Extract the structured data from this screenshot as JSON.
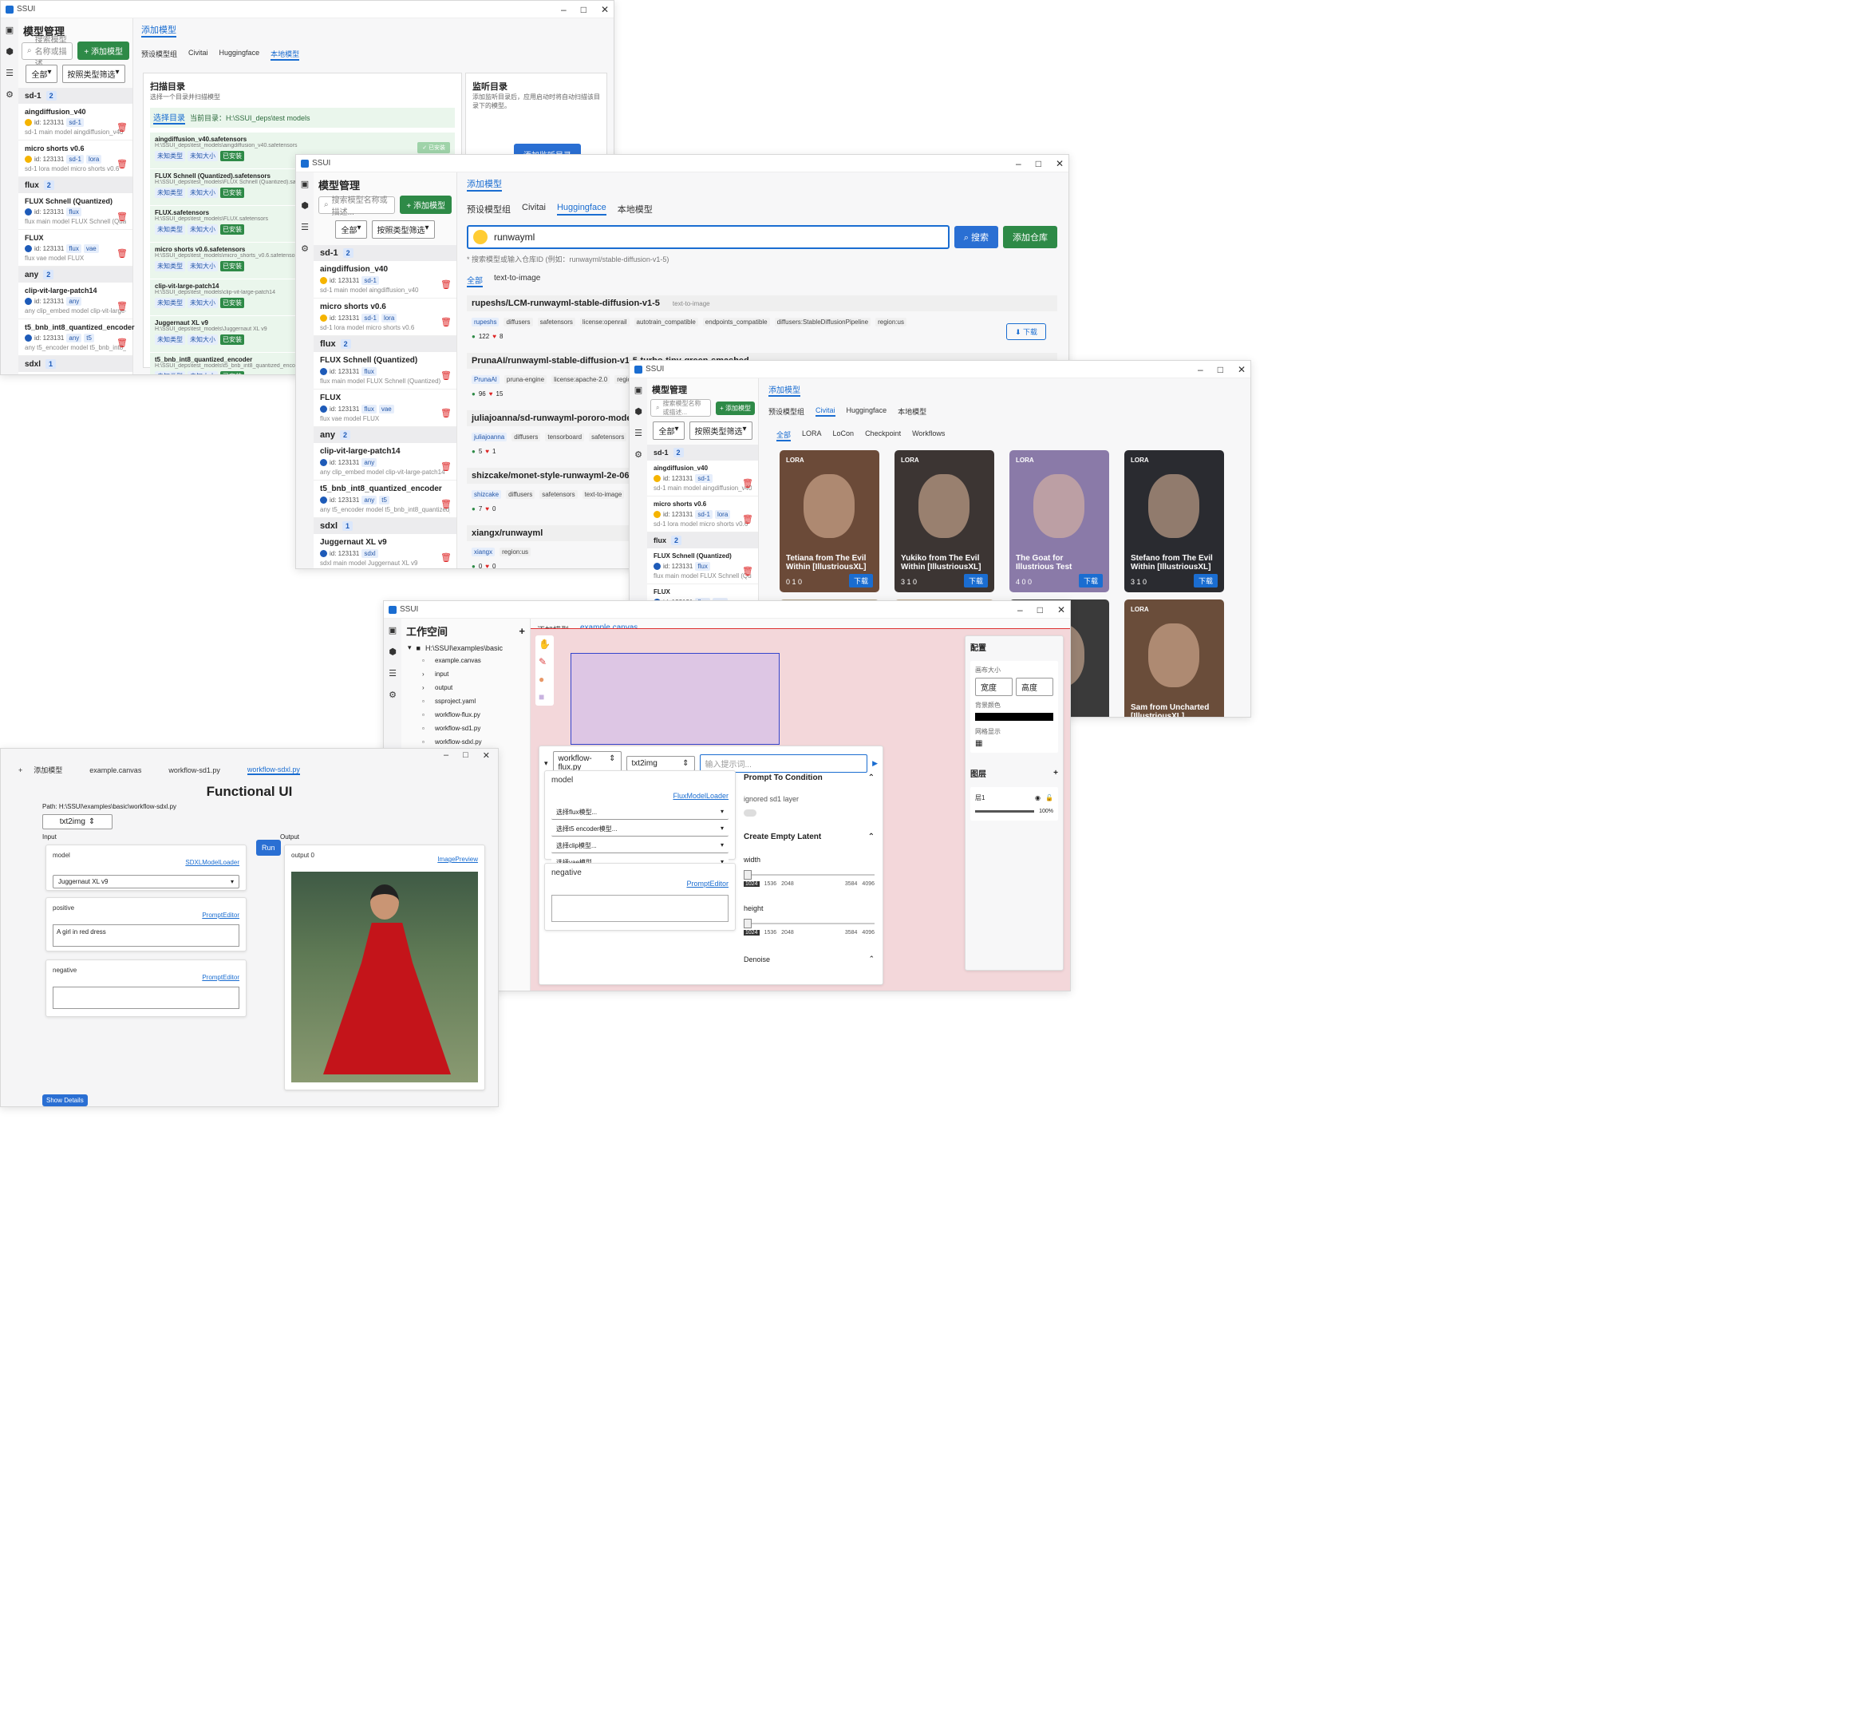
{
  "app": {
    "title": "SSUI",
    "win_min": "–",
    "win_max": "□",
    "win_close": "✕"
  },
  "w1": {
    "sidebar": {
      "title": "模型管理",
      "search_placeholder": "搜索模型名称或描述...",
      "add_model": "+ 添加模型",
      "filter_all": "全部",
      "filter_sort": "按照类型筛选",
      "groups": [
        {
          "name": "sd-1",
          "count": "2",
          "items": [
            {
              "name": "aingdiffusion_v40",
              "id": "id: 123131",
              "tag": "sd-1",
              "path": "sd-1 main model aingdiffusion_v40"
            },
            {
              "name": "micro shorts v0.6",
              "id": "id: 123131",
              "tag": "sd-1",
              "tag2": "lora",
              "path": "sd-1 lora model micro shorts v0.6"
            }
          ]
        },
        {
          "name": "flux",
          "count": "2",
          "items": [
            {
              "name": "FLUX Schnell (Quantized)",
              "id": "id: 123131",
              "tag": "flux",
              "path": "flux main model FLUX Schnell (Quantized)"
            },
            {
              "name": "FLUX",
              "id": "id: 123131",
              "tag": "flux",
              "tag2": "vae",
              "path": "flux vae model FLUX"
            }
          ]
        },
        {
          "name": "any",
          "count": "2",
          "items": [
            {
              "name": "clip-vit-large-patch14",
              "id": "id: 123131",
              "tag": "any",
              "path": "any clip_embed model clip-vit-large-patch14"
            },
            {
              "name": "t5_bnb_int8_quantized_encoder",
              "id": "id: 123131",
              "tag": "any",
              "tag2": "t5",
              "path": "any t5_encoder model t5_bnb_int8_quantized_encoder"
            }
          ]
        },
        {
          "name": "sdxl",
          "count": "1",
          "items": [
            {
              "name": "Juggernaut XL v9",
              "id": "id: 123131",
              "tag": "sdxl",
              "path": "sdxl main model Juggernaut XL v9"
            }
          ]
        }
      ]
    },
    "top_tab": "添加模型",
    "tabs": [
      "预设模型组",
      "Civitai",
      "Huggingface",
      "本地模型"
    ],
    "scan_title": "扫描目录",
    "scan_desc": "选择一个目录并扫描模型",
    "choose_dir": "选择目录",
    "current_dir": "当前目录：H:\\SSUI_deps\\test models",
    "files": [
      {
        "name": "aingdiffusion_v40.safetensors",
        "path": "H:\\SSUI_deps\\test_models\\aingdiffusion_v40.safetensors",
        "state": "✓ 已安装"
      },
      {
        "name": "FLUX Schnell (Quantized).safetensors",
        "path": "H:\\SSUI_deps\\test_models\\FLUX Schnell (Quantized).safetensors"
      },
      {
        "name": "FLUX.safetensors",
        "path": "H:\\SSUI_deps\\test_models\\FLUX.safetensors"
      },
      {
        "name": "micro shorts v0.6.safetensors",
        "path": "H:\\SSUI_deps\\test_models\\micro_shorts_v0.6.safetensors"
      },
      {
        "name": "clip-vit-large-patch14",
        "path": "H:\\SSUI_deps\\test_models\\clip-vit-large-patch14"
      },
      {
        "name": "Juggernaut XL v9",
        "path": "H:\\SSUI_deps\\test_models\\Juggernaut XL v9"
      },
      {
        "name": "t5_bnb_int8_quantized_encoder",
        "path": "H:\\SSUI_deps\\test_models\\t5_bnb_int8_quantized_encoder"
      }
    ],
    "file_tags": [
      "未知类型",
      "未知大小",
      "已安装"
    ],
    "watch_title": "监听目录",
    "watch_desc": "添加监听目录后，应用启动时将自动扫描该目录下的模型。",
    "add_watch": "添加监听目录"
  },
  "w2": {
    "top_tab": "添加模型",
    "tabs": [
      "预设模型组",
      "Civitai",
      "Huggingface",
      "本地模型"
    ],
    "search_value": "runwayml",
    "search_btn": "搜索",
    "add_repo": "添加仓库",
    "hint": "* 搜索模型或输入仓库ID (例如：runwayml/stable-diffusion-v1-5)",
    "filter_tabs": [
      "全部",
      "text-to-image"
    ],
    "results": [
      {
        "name": "rupeshs/LCM-runwayml-stable-diffusion-v1-5",
        "type": "text-to-image",
        "tags": [
          "rupeshs",
          "diffusers",
          "safetensors",
          "license:openrail",
          "autotrain_compatible",
          "endpoints_compatible",
          "diffusers:StableDiffusionPipeline",
          "region:us"
        ],
        "likes": "122",
        "hearts": "8",
        "download": "下载"
      },
      {
        "name": "PrunaAI/runwayml-stable-diffusion-v1-5-turbo-tiny-green-smashed",
        "tags": [
          "PrunaAI",
          "pruna-engine",
          "license:apache-2.0",
          "region:us"
        ],
        "likes": "96",
        "hearts": "15"
      },
      {
        "name": "juliajoanna/sd-runwayml-pororo-model",
        "type": "text",
        "tags": [
          "juliajoanna",
          "diffusers",
          "tensorboard",
          "safetensors",
          "base_model:finetune:runwayml/stable-diffusion-v1-5"
        ],
        "likes": "5",
        "hearts": "1"
      },
      {
        "name": "shizcake/monet-style-runwayml-2e-06-8-pix",
        "tags": [
          "shizcake",
          "diffusers",
          "safetensors",
          "text-to-image"
        ],
        "likes": "7",
        "hearts": "0"
      },
      {
        "name": "xiangx/runwayml",
        "tags": [
          "xiangx",
          "region:us"
        ],
        "likes": "0",
        "hearts": "0"
      }
    ]
  },
  "w3": {
    "top_tab": "添加模型",
    "tabs": [
      "预设模型组",
      "Civitai",
      "Huggingface",
      "本地模型"
    ],
    "filters": [
      "全部",
      "LORA",
      "LoCon",
      "Checkpoint",
      "Workflows"
    ],
    "cards": [
      {
        "type": "LORA",
        "title": "Tetiana from The Evil Within [IllustriousXL]",
        "stats": "0  1  0",
        "dl": "下载",
        "bg": "#6b4a38"
      },
      {
        "type": "LORA",
        "title": "Yukiko from The Evil Within [IllustriousXL]",
        "stats": "3  1  0",
        "dl": "下载",
        "bg": "#3c3533"
      },
      {
        "type": "LORA",
        "title": "The Goat for Illustrious Test",
        "stats": "4  0  0",
        "dl": "下载",
        "bg": "#8a7aa8"
      },
      {
        "type": "LORA",
        "title": "Stefano from The Evil Within [IllustriousXL]",
        "stats": "3  1  0",
        "dl": "下载",
        "bg": "#2a2b30"
      },
      {
        "type": "LORA",
        "title": "",
        "stats": "",
        "dl": "",
        "bg": "#b7a98f"
      },
      {
        "type": "LORA",
        "title": "",
        "stats": "",
        "dl": "",
        "bg": "#c8b090"
      },
      {
        "type": "LORA",
        "title": "Within [Illustri",
        "stats": "",
        "dl": "下载",
        "bg": "#3a3a3a"
      },
      {
        "type": "LORA",
        "title": "Sam from Uncharted [IllustriousXL]",
        "stats": "6  1  0",
        "dl": "下载",
        "bg": "#6a4d3a"
      }
    ]
  },
  "w4": {
    "workspace": "工作空间",
    "tree_root": "H:\\SSUI\\examples\\basic",
    "tree": [
      "example.canvas",
      "input",
      "output",
      "ssproject.yaml",
      "workflow-flux.py",
      "workflow-sd1.py",
      "workflow-sdxl.py"
    ],
    "tabs": [
      "添加模型",
      "example.canvas"
    ],
    "panel_workflow": "workflow-flux.py",
    "panel_mode": "txt2img",
    "prompt_placeholder": "输入提示词...",
    "model_label": "model",
    "model_link": "FluxModelLoader",
    "selects": [
      "选择flux模型...",
      "选择t5 encoder模型...",
      "选择clip模型...",
      "选择vae模型..."
    ],
    "negative_label": "negative",
    "negative_link": "PromptEditor",
    "right": {
      "s1": "Prompt To Condition",
      "s1_opt": "ignored sd1 layer",
      "s2": "Create Empty Latent",
      "width": "width",
      "height": "height",
      "w_val": "1024",
      "ticks": [
        "1536",
        "2048",
        "3584",
        "4096"
      ],
      "s3": "Denoise"
    },
    "config": {
      "title": "配置",
      "size_label": "画布大小",
      "w": "宽度",
      "h": "高度",
      "bg_label": "背景颜色",
      "grid_label": "网格显示"
    },
    "layers": {
      "title": "图层",
      "name": "层1",
      "opacity": "100%"
    }
  },
  "w5": {
    "tabs": [
      "添加模型",
      "example.canvas",
      "workflow-sd1.py",
      "workflow-sdxl.py"
    ],
    "title": "Functional UI",
    "path": "Path: H:\\SSUI\\examples\\basic\\workflow-sdxl.py",
    "mode": "txt2img",
    "input_label": "Input",
    "output_label": "Output",
    "run": "Run",
    "model_label": "model",
    "model_link": "SDXLModelLoader",
    "model_value": "Juggernaut XL v9",
    "positive_label": "positive",
    "positive_link": "PromptEditor",
    "positive_value": "A girl in red dress",
    "negative_label": "negative",
    "negative_link": "PromptEditor",
    "output_title": "output 0",
    "output_link": "ImagePreview",
    "show_details": "Show Details"
  },
  "colors": {
    "accent": "#1a6dd1",
    "green": "#2e8a47",
    "delete": "#d22222",
    "canvas": "#f3d7da"
  }
}
